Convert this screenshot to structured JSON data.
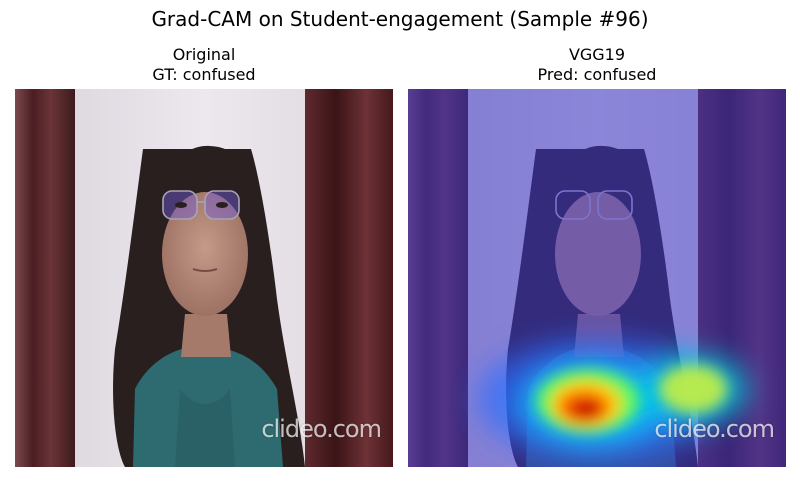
{
  "figure": {
    "title": "Grad-CAM on Student-engagement (Sample #96)"
  },
  "panels": [
    {
      "title_line1": "Original",
      "title_line2": "GT: confused",
      "watermark": "clideo.com"
    },
    {
      "title_line1": "VGG19",
      "title_line2": "Pred: confused",
      "watermark": "clideo.com"
    }
  ],
  "colors": {
    "curtain": "#5a2a2e",
    "wall": "#e6e1e6",
    "hair": "#2a1f1f",
    "skin": "#b98c7c",
    "shirt": "#2e6b70",
    "overlay_tint": "#3c34c8",
    "heat_peak": "#c80000"
  }
}
